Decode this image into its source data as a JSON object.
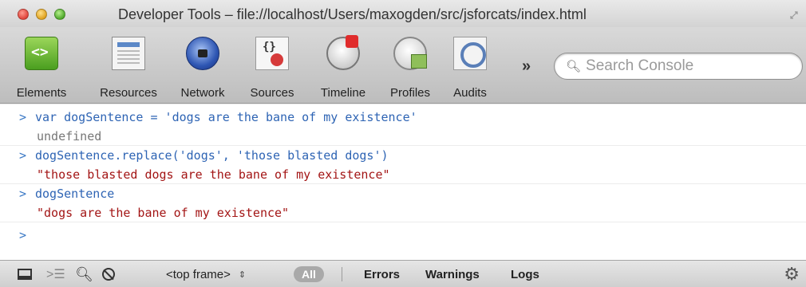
{
  "window": {
    "title": "Developer Tools – file://localhost/Users/maxogden/src/jsforcats/index.html"
  },
  "toolbar": {
    "tabs": [
      {
        "label": "Elements",
        "icon": "elements-icon"
      },
      {
        "label": "Resources",
        "icon": "resources-icon"
      },
      {
        "label": "Network",
        "icon": "network-icon"
      },
      {
        "label": "Sources",
        "icon": "sources-icon"
      },
      {
        "label": "Timeline",
        "icon": "timeline-icon"
      },
      {
        "label": "Profiles",
        "icon": "profiles-icon"
      },
      {
        "label": "Audits",
        "icon": "audits-icon"
      }
    ],
    "more": "»",
    "search_placeholder": "Search Console"
  },
  "console": {
    "prompt": ">",
    "entries": [
      {
        "input": "var dogSentence = 'dogs are the bane of my existence'",
        "output": "undefined",
        "output_type": "undefined"
      },
      {
        "input": "dogSentence.replace('dogs', 'those blasted dogs')",
        "output": "\"those blasted dogs are the bane of my existence\"",
        "output_type": "string"
      },
      {
        "input": "dogSentence",
        "output": "\"dogs are the bane of my existence\"",
        "output_type": "string"
      }
    ]
  },
  "statusbar": {
    "frame_label": "<top frame>",
    "frame_arrows": "⇕",
    "filter_all": "All",
    "filters": [
      "Errors",
      "Warnings",
      "Logs"
    ]
  },
  "colors": {
    "input": "#2e64b4",
    "string_output": "#a31515",
    "undefined_output": "#777777"
  }
}
